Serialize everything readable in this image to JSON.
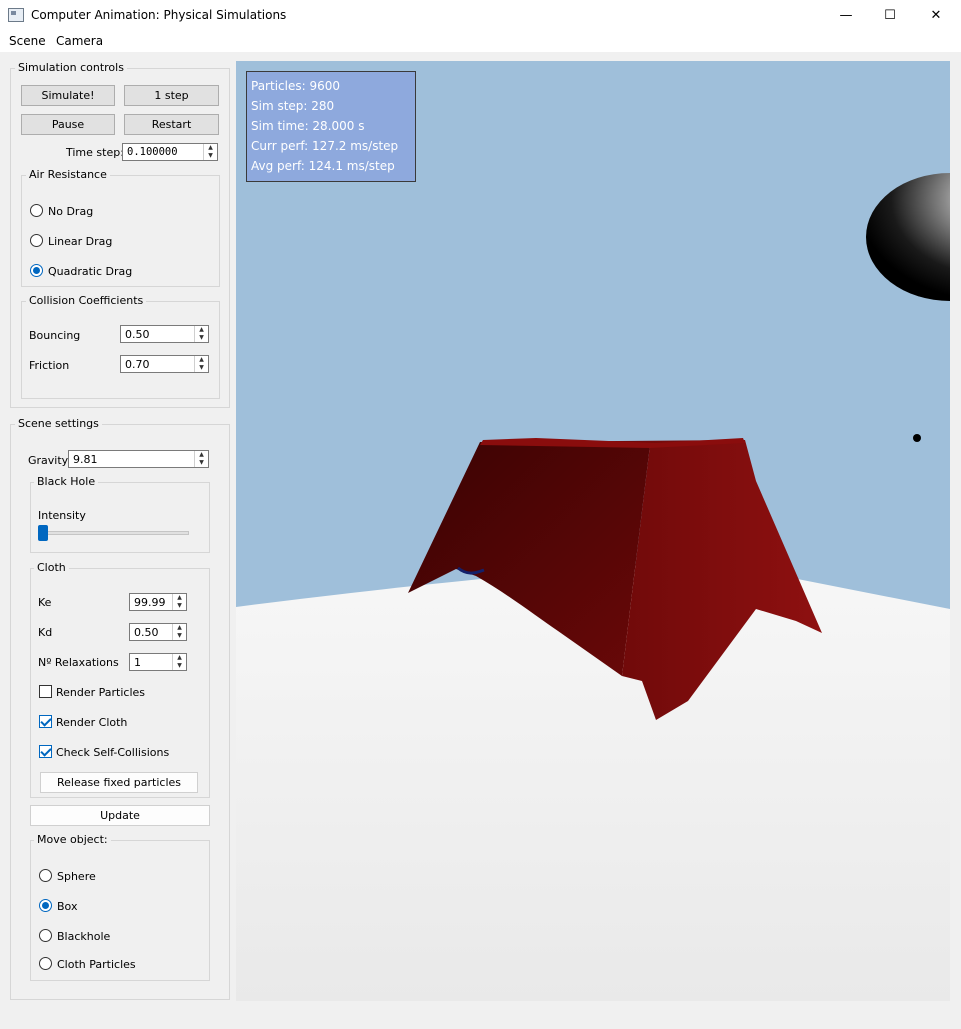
{
  "window": {
    "title": "Computer Animation: Physical Simulations",
    "minimize": "—",
    "maximize": "☐",
    "close": "✕"
  },
  "menu": {
    "items": [
      "Scene",
      "Camera"
    ]
  },
  "simulation_controls": {
    "title": "Simulation controls",
    "simulate_label": "Simulate!",
    "step_label": "1 step",
    "pause_label": "Pause",
    "restart_label": "Restart",
    "timestep_label": "Time step:",
    "timestep_value": "0.100000"
  },
  "air_resistance": {
    "title": "Air Resistance",
    "options": [
      "No Drag",
      "Linear Drag",
      "Quadratic Drag"
    ],
    "selected": "Quadratic Drag"
  },
  "collision": {
    "title": "Collision Coefficients",
    "bouncing_label": "Bouncing",
    "bouncing_value": "0.50",
    "friction_label": "Friction",
    "friction_value": "0.70"
  },
  "scene_settings": {
    "title": "Scene settings",
    "gravity_label": "Gravity",
    "gravity_value": "9.81",
    "black_hole": {
      "title": "Black Hole",
      "intensity_label": "Intensity",
      "intensity_fraction": 0.0
    },
    "cloth": {
      "title": "Cloth",
      "ke_label": "Ke",
      "ke_value": "99.99",
      "kd_label": "Kd",
      "kd_value": "0.50",
      "relax_label": "Nº Relaxations",
      "relax_value": "1",
      "render_particles_label": "Render Particles",
      "render_particles": false,
      "render_cloth_label": "Render Cloth",
      "render_cloth": true,
      "self_collisions_label": "Check Self-Collisions",
      "self_collisions": true,
      "release_label": "Release fixed particles"
    },
    "update_label": "Update",
    "move_object": {
      "title": "Move object:",
      "options": [
        "Sphere",
        "Box",
        "Blackhole",
        "Cloth Particles"
      ],
      "selected": "Box"
    }
  },
  "hud": {
    "particles": "Particles: 9600",
    "sim_step": "Sim step:  280",
    "sim_time": "Sim time:  28.000 s",
    "curr_perf": "Curr perf: 127.2 ms/step",
    "avg_perf": "Avg perf:  124.1 ms/step"
  },
  "colors": {
    "sky": "#9fbfda",
    "floor": "#f0f0f0",
    "cloth": "#5a0606",
    "accent": "#0067c0",
    "hud": "#8ea9dd"
  }
}
